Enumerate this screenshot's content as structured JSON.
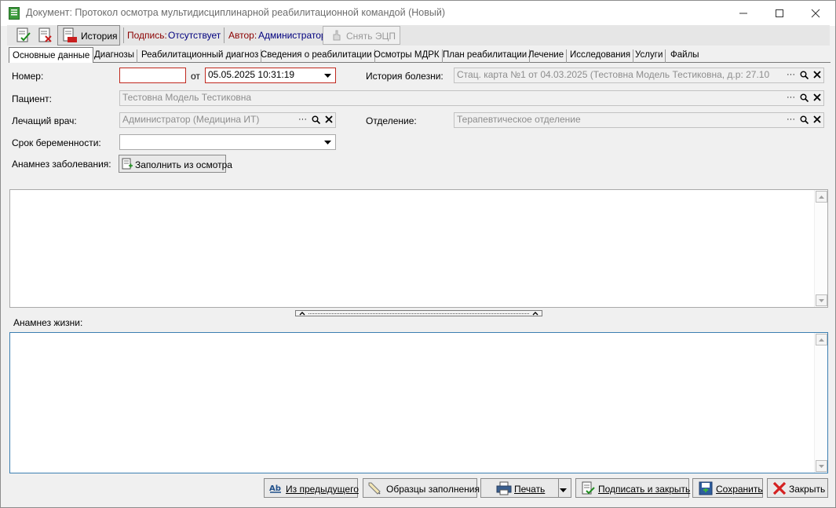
{
  "window": {
    "title": "Документ: Протокол осмотра мультидисциплинарной реабилитационной командой (Новый)"
  },
  "toolbar": {
    "history_label": "История",
    "signature_label": "Подпись:",
    "signature_value": "Отсутствует",
    "author_label": "Автор:",
    "author_value": "Администратор",
    "remove_ecp_label": "Снять ЭЦП"
  },
  "tabs": [
    {
      "label": "Основные данные",
      "active": true
    },
    {
      "label": "Диагнозы"
    },
    {
      "label": "Реабилитационный диагноз"
    },
    {
      "label": "Сведения о реабилитации"
    },
    {
      "label": "Осмотры МДРК"
    },
    {
      "label": "План реабилитации"
    },
    {
      "label": "Лечение"
    },
    {
      "label": "Исследования"
    },
    {
      "label": "Услуги"
    },
    {
      "label": "Файлы"
    }
  ],
  "form": {
    "number_label": "Номер:",
    "number_value": "",
    "from_label": "от",
    "date_value": "05.05.2025 10:31:19",
    "history_label": "История болезни:",
    "history_value": "Стац. карта №1 от 04.03.2025 (Тестовна Модель Тестиковна, д.р: 27.10",
    "patient_label": "Пациент:",
    "patient_value": "Тестовна Модель Тестиковна",
    "doctor_label": "Лечащий врач:",
    "doctor_value": "Администратор (Медицина ИТ)",
    "department_label": "Отделение:",
    "department_value": "Терапевтическое отделение",
    "pregnancy_label": "Срок беременности:",
    "pregnancy_value": "",
    "anamnesis_label": "Анамнез заболевания:",
    "fill_from_exam_label": "Заполнить из осмотра",
    "anamnesis_value": "",
    "life_anamnesis_label": "Анамнез жизни:",
    "life_anamnesis_value": ""
  },
  "bottom_buttons": {
    "from_previous": "Из предыдущего",
    "samples": "Образцы заполнения",
    "print": "Печать",
    "sign_close": "Подписать и закрыть",
    "save": "Сохранить",
    "close": "Закрыть"
  },
  "colors": {
    "required_border": "#c0281e",
    "signature_red": "#8b0000",
    "author_navy": "#00007f",
    "close_icon_red": "#d42020"
  }
}
